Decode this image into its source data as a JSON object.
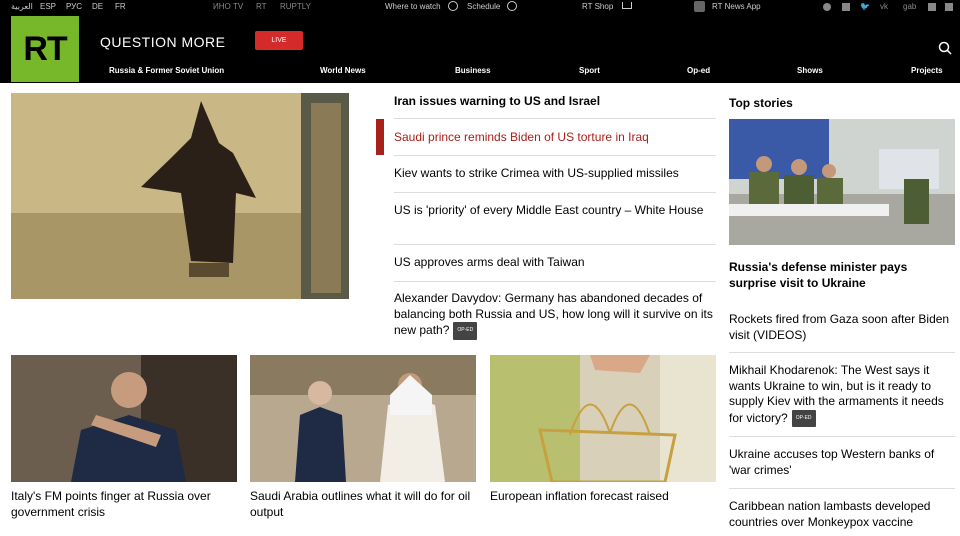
{
  "topbar": {
    "languages": [
      "العربية",
      "ESP",
      "РУС",
      "DE",
      "FR"
    ],
    "partners": [
      "ИНО TV",
      "RT",
      "RUPTLY"
    ],
    "where_to_watch": "Where to watch",
    "schedule": "Schedule",
    "shop": "RT Shop",
    "app": "RT News App",
    "social": [
      "telegram",
      "rss",
      "twitter",
      "vk",
      "gab",
      "facebook",
      "share"
    ]
  },
  "header": {
    "logo": "RT",
    "tagline": "QUESTION MORE",
    "live": "LIVE",
    "nav": [
      "Russia & Former Soviet Union",
      "World News",
      "Business",
      "Sport",
      "Op-ed",
      "Shows",
      "Projects"
    ]
  },
  "main": {
    "headlines": [
      {
        "text": "Iran issues warning to US and Israel",
        "bold": true
      },
      {
        "text": "Saudi prince reminds Biden of US torture in Iraq",
        "active": true
      },
      {
        "text": "Kiev wants to strike Crimea with US-supplied missiles"
      },
      {
        "text": "US is 'priority' of every Middle East country – White House"
      },
      {
        "text": "US approves arms deal with Taiwan"
      },
      {
        "text": "Alexander Davydov: Germany has abandoned decades of balancing both Russia and US, how long will it survive on its new path?",
        "tag": "OP-ED"
      }
    ],
    "cards": [
      {
        "title": "Italy's FM points finger at Russia over government crisis"
      },
      {
        "title": "Saudi Arabia outlines what it will do for oil output"
      },
      {
        "title": "European inflation forecast raised"
      }
    ]
  },
  "sidebar": {
    "title": "Top stories",
    "lead": "Russia's defense minister pays surprise visit to Ukraine",
    "items": [
      {
        "text": "Rockets fired from Gaza soon after Biden visit (VIDEOS)"
      },
      {
        "text": "Mikhail Khodarenok: The West says it wants Ukraine to win, but is it ready to supply Kiev with the armaments it needs for victory?",
        "tag": "OP-ED"
      },
      {
        "text": "Ukraine accuses top Western banks of 'war crimes'"
      },
      {
        "text": "Caribbean nation lambasts developed countries over Monkeypox vaccine"
      }
    ]
  },
  "colors": {
    "accent": "#77b82a",
    "live": "#d42a2a",
    "active": "#a8201a"
  }
}
